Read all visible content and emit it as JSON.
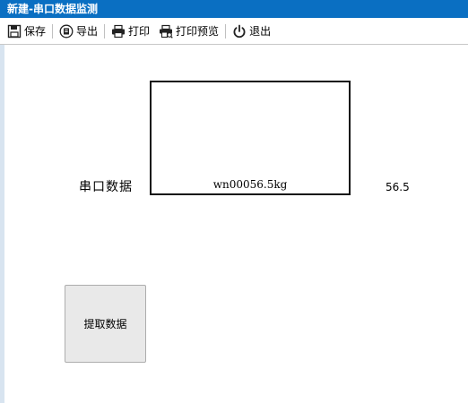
{
  "window": {
    "title": "新建-串口数据监测"
  },
  "toolbar": {
    "save_label": "保存",
    "export_label": "导出",
    "print_label": "打印",
    "print_preview_label": "打印预览",
    "exit_label": "退出"
  },
  "main": {
    "serial_label": "串口数据",
    "serial_text": "wn00056.5kg",
    "value": "56.5",
    "fetch_button_label": "提取数据"
  },
  "colors": {
    "titlebar": "#0a6fc2",
    "button_bg": "#e9e9e9"
  },
  "icons": [
    "save-icon",
    "export-icon",
    "print-icon",
    "print-preview-icon",
    "power-icon"
  ]
}
